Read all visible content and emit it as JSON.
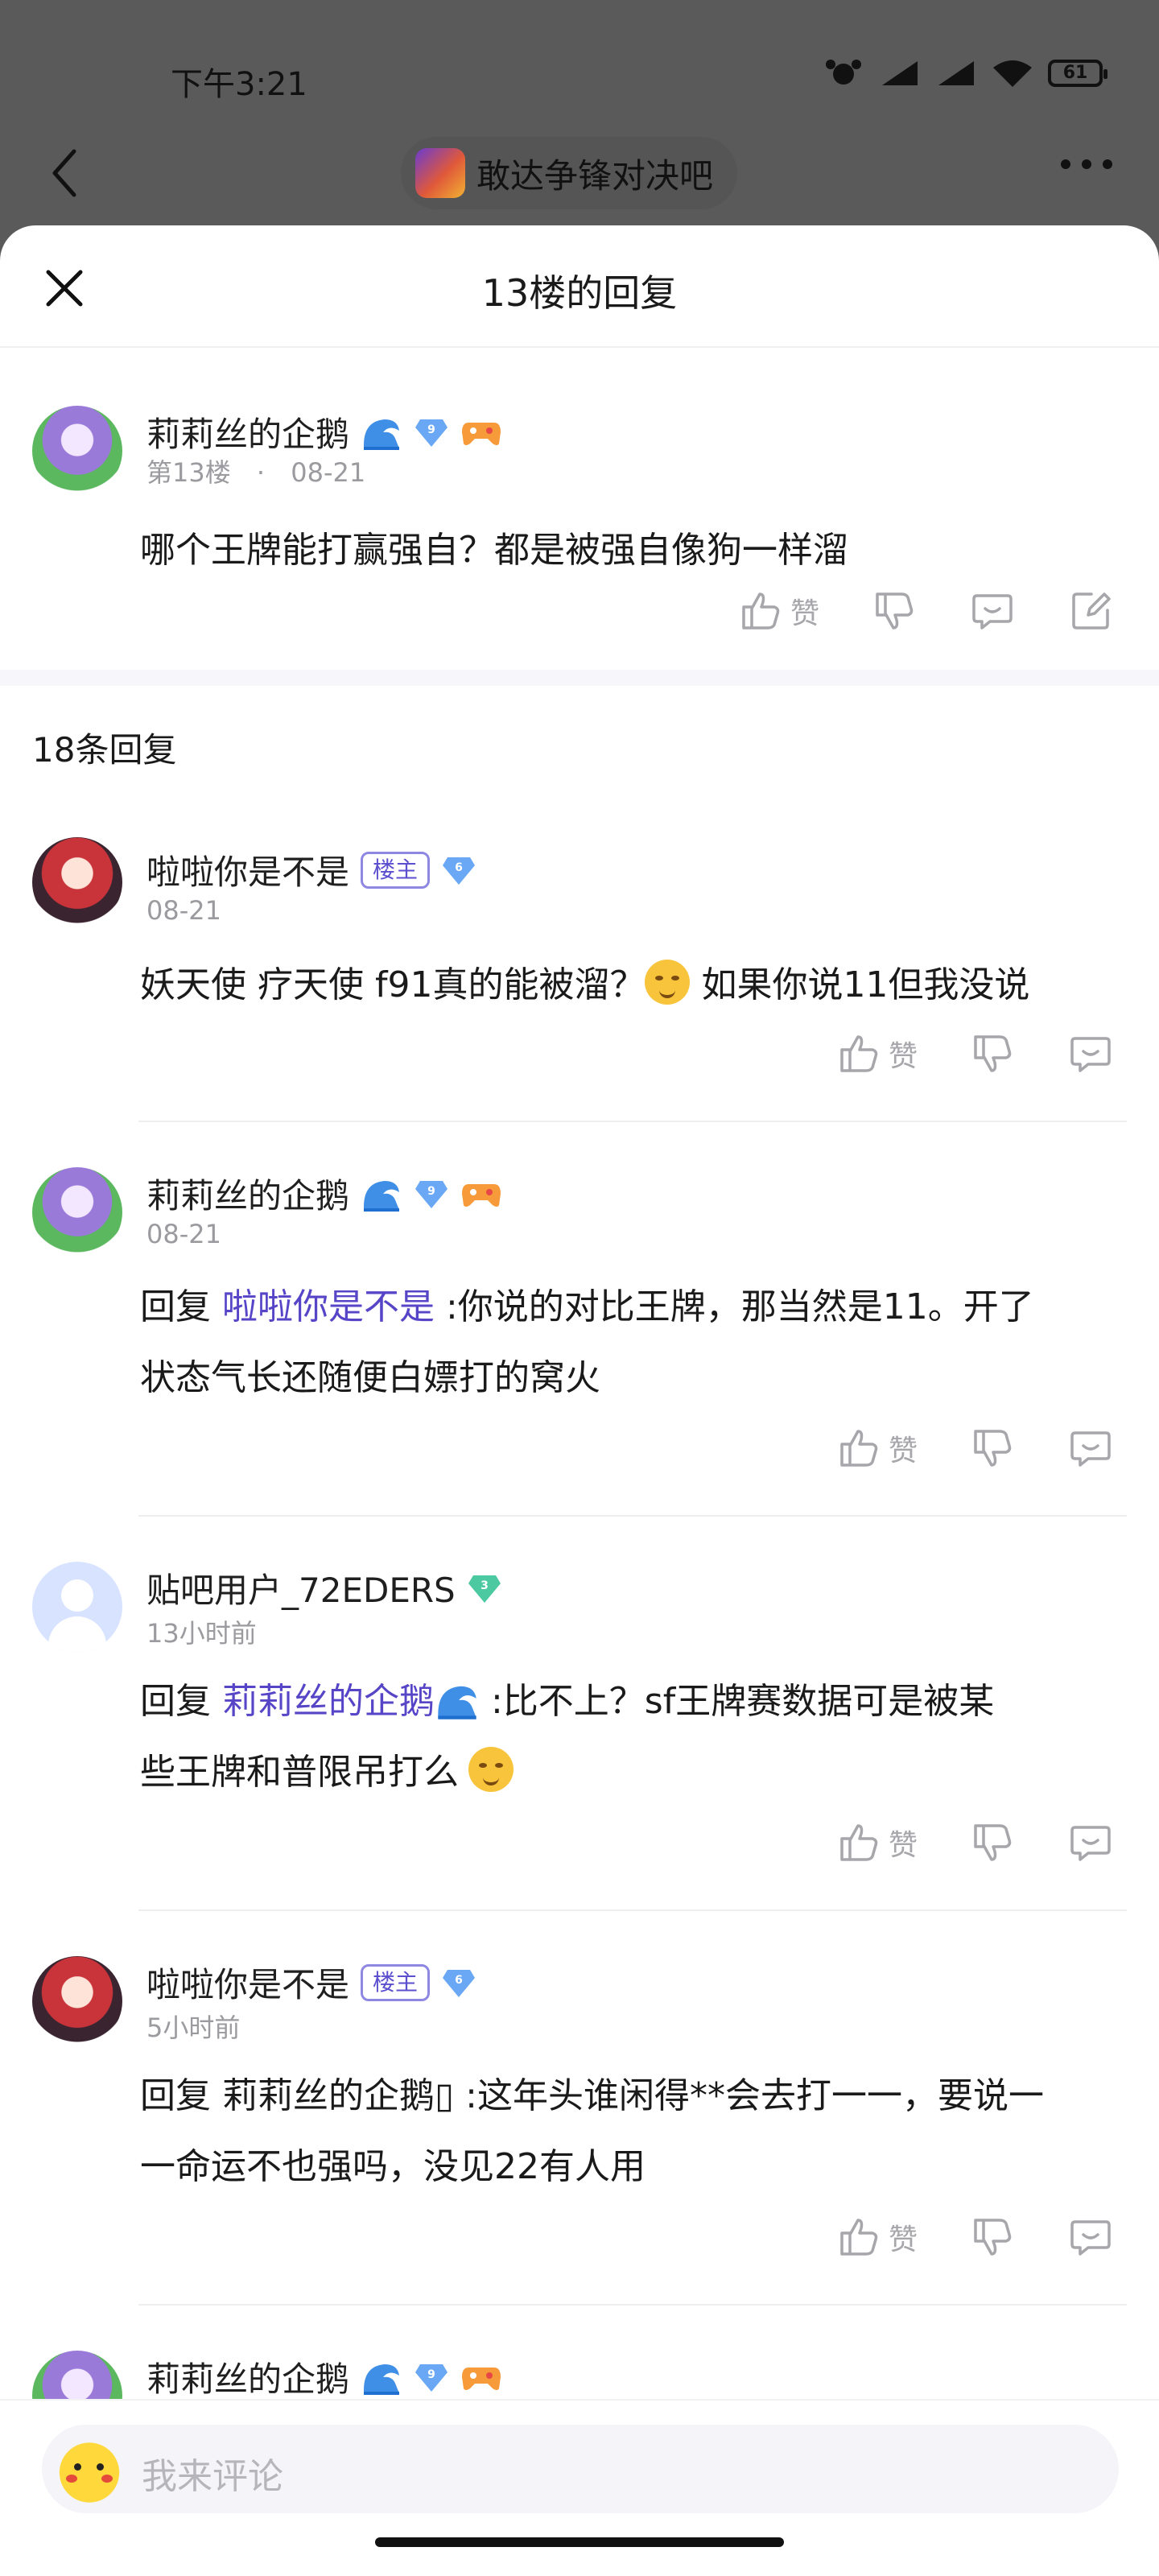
{
  "status_bar": {
    "time": "下午3:21",
    "battery": "61"
  },
  "nav": {
    "forum_name": "敢达争锋对决吧"
  },
  "sheet": {
    "title": "13楼的回复"
  },
  "main_post": {
    "username": "莉莉丝的企鹅",
    "level": "9",
    "floor": "第13楼",
    "dot": "·",
    "date": "08-21",
    "content": "哪个王牌能打赢强自？都是被强自像狗一样溜",
    "like_label": "赞"
  },
  "reply_count": "18条回复",
  "replies": [
    {
      "username": "啦啦你是不是",
      "badge": "楼主",
      "level": "6",
      "time": "08-21",
      "content_a": "妖天使 疗天使 f91真的能被溜？",
      "content_b": " 如果你说11但我没说",
      "like_label": "赞"
    },
    {
      "username": "莉莉丝的企鹅",
      "level": "9",
      "time": "08-21",
      "reply_prefix": "回复 ",
      "reply_to": "啦啦你是不是",
      "content_a": " :你说的对比王牌，那当然是11。开了",
      "content_b": "状态气长还随便白嫖打的窝火",
      "like_label": "赞"
    },
    {
      "username": "贴吧用户_72EDERS",
      "level": "3",
      "time": "13小时前",
      "reply_prefix": "回复 ",
      "reply_to": "莉莉丝的企鹅",
      "content_a": " :比不上？sf王牌赛数据可是被某",
      "content_b": "些王牌和普限吊打么",
      "like_label": "赞"
    },
    {
      "username": "啦啦你是不是",
      "badge": "楼主",
      "level": "6",
      "time": "5小时前",
      "content_a": "回复 莉莉丝的企鹅▯ :这年头谁闲得**会去打一一，要说一",
      "content_b": "一命运不也强吗，没见22有人用",
      "like_label": "赞"
    },
    {
      "username": "莉莉丝的企鹅",
      "level": "9"
    }
  ],
  "composer": {
    "placeholder": "我来评论"
  },
  "colors": {
    "link": "#5646c7",
    "muted": "#9a9a9f",
    "badge": "#5b4fcf"
  }
}
